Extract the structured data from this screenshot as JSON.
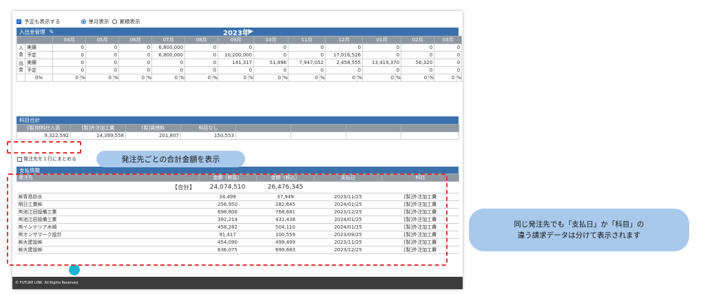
{
  "options": {
    "show_plan_label": "予定も表示する",
    "single_month_label": "単月表示",
    "cumulative_label": "累積表示"
  },
  "cash": {
    "title": "入出金管理",
    "year": "2023年",
    "months": [
      "04月",
      "05月",
      "06月",
      "07月",
      "08月",
      "09月",
      "10月",
      "11月",
      "12月",
      "01月",
      "02月",
      "03月"
    ],
    "in_label": "入金",
    "out_label": "出金",
    "actual_label": "実績",
    "plan_label": "予定",
    "in_actual": [
      "0",
      "0",
      "0",
      "6,800,000",
      "0",
      "0",
      "0",
      "0",
      "0",
      "0",
      "0",
      "0"
    ],
    "in_plan": [
      "0",
      "0",
      "0",
      "6,800,000",
      "0",
      "10,200,000",
      "0",
      "0",
      "17,016,526",
      "0",
      "0",
      "0"
    ],
    "out_actual": [
      "0",
      "0",
      "0",
      "0",
      "0",
      "141,317",
      "51,896",
      "7,947,052",
      "2,458,555",
      "13,419,370",
      "56,320",
      "0"
    ],
    "out_plan": [
      "0",
      "0",
      "0",
      "0",
      "0",
      "0",
      "0",
      "0",
      "0",
      "0",
      "0",
      "0"
    ],
    "pct_label": "0%",
    "pct_values": [
      "0",
      "0",
      "0",
      "0",
      "0",
      "0",
      "0",
      "0",
      "0",
      "0",
      "0",
      "0"
    ],
    "pct_unit": "%"
  },
  "subjects": {
    "title": "科目合計",
    "headers": [
      "[製]材料仕入高",
      "[製]外注加工費",
      "[製]賃借料",
      "科目なし"
    ],
    "values": [
      "9,322,592",
      "14,399,558",
      "201,807",
      "150,553"
    ]
  },
  "merge_label": "発注先を１行にまとめる",
  "payment": {
    "title": "支払情報",
    "headers": {
      "vendor": "発注先",
      "amount_ex": "金額（税抜）",
      "amount_in": "金額（税込）",
      "date": "支払日",
      "subject": "科目"
    },
    "total_label": "【合計】",
    "total_ex": "24,074,510",
    "total_in": "26,476,345",
    "rows": [
      {
        "vendor": "㈱青島防水",
        "ex": "34,499",
        "in": "37,949",
        "date": "2023/11/25",
        "subject": "[製]外注加工費"
      },
      {
        "vendor": "明日工業㈱",
        "ex": "256,950",
        "in": "282,645",
        "date": "2024/01/25",
        "subject": "[製]外注加工費"
      },
      {
        "vendor": "㈲池江田設備工業",
        "ex": "698,800",
        "in": "768,681",
        "date": "2023/12/25",
        "subject": "[製]外注加工費"
      },
      {
        "vendor": "㈲池江田設備工業",
        "ex": "392,214",
        "in": "431,438",
        "date": "2024/01/25",
        "subject": "[製]外注加工費"
      },
      {
        "vendor": "㈲インテリア木崎",
        "ex": "458,282",
        "in": "504,110",
        "date": "2024/01/25",
        "subject": "[製]外注加工費"
      },
      {
        "vendor": "㈲オンザマーク設計",
        "ex": "91,417",
        "in": "100,559",
        "date": "2023/09/25",
        "subject": "[製]外注加工費"
      },
      {
        "vendor": "㈱大建設㈱",
        "ex": "454,090",
        "in": "499,499",
        "date": "2023/11/25",
        "subject": "[製]外注加工費"
      },
      {
        "vendor": "㈱大建設㈱",
        "ex": "636,075",
        "in": "699,683",
        "date": "2023/12/25",
        "subject": "[製]外注加工費"
      }
    ]
  },
  "footer": "© FUTURE LINK. All Rights Reserved.",
  "callouts": {
    "one": "発注先ごとの合計金額を表示",
    "two_line1": "同じ発注先でも「支払日」か「科目」の",
    "two_line2": "違う請求データは分けて表示されます"
  },
  "colors": {
    "bar": "#3a71ad",
    "header": "#8e98a3",
    "dash": "#e03030",
    "callout": "#a9c9ec"
  }
}
